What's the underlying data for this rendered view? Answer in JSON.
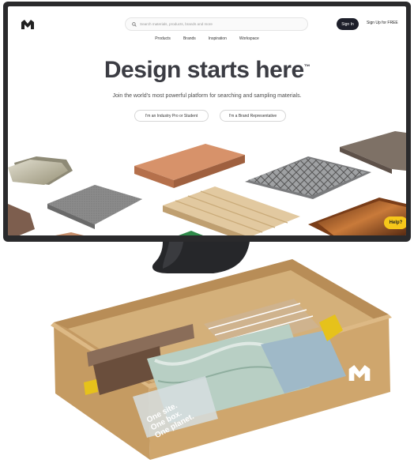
{
  "nav": {
    "search_placeholder": "Search materials, products, brands and more",
    "sign_in": "Sign In",
    "sign_up": "Sign Up for FREE",
    "links": [
      "Products",
      "Brands",
      "Inspiration",
      "Workspace"
    ]
  },
  "hero": {
    "title": "Design starts here",
    "trademark": "™",
    "subtitle": "Join the world's most powerful platform for searching and sampling materials.",
    "cta_pro": "I'm an Industry Pro or Student",
    "cta_brand": "I'm a Brand Representative"
  },
  "help_label": "Help?",
  "box": {
    "tagline": [
      "One site.",
      "One box.",
      "One planet."
    ]
  },
  "colors": {
    "nav_dark": "#1d1f2a",
    "help_yellow": "#f6c71a",
    "cardboard": "#c6a06b"
  }
}
